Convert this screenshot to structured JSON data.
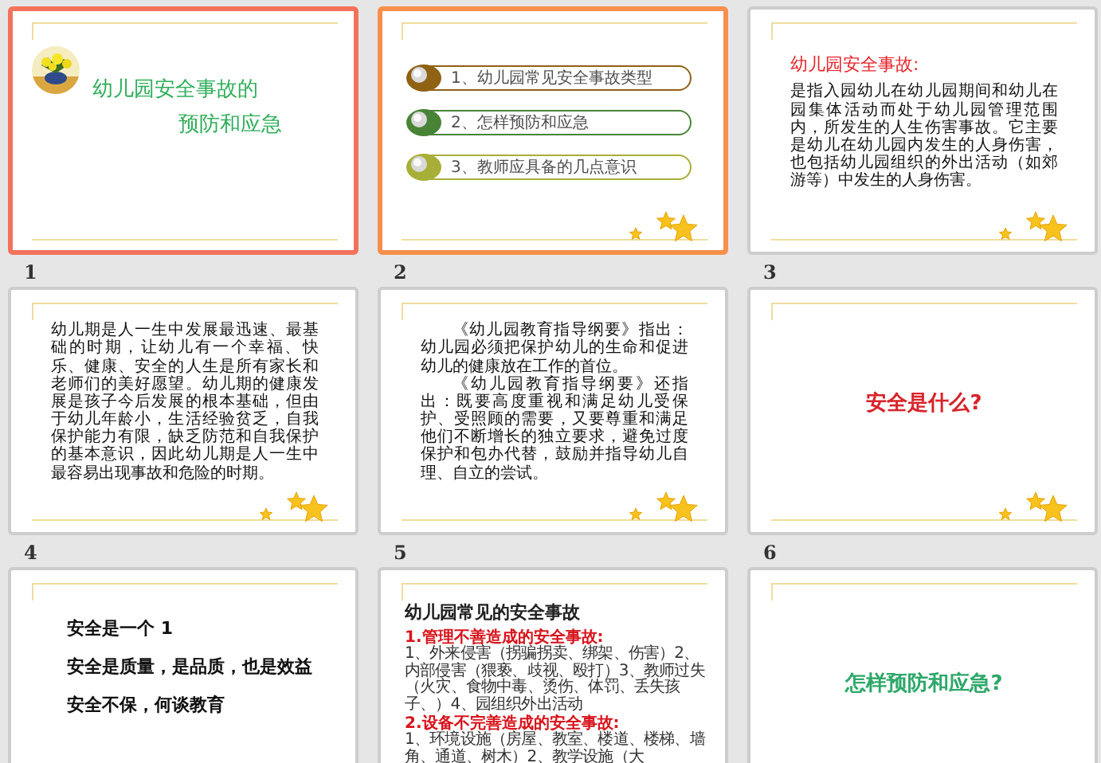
{
  "slides": [
    {
      "number": "1",
      "selected": true,
      "hovered": false,
      "kind": "title",
      "lines": [
        "幼儿园安全事故的",
        "预防和应急"
      ]
    },
    {
      "number": "2",
      "selected": false,
      "hovered": true,
      "kind": "menu",
      "items": [
        {
          "text": "1、幼儿园常见安全事故类型",
          "color": "#8a5a08"
        },
        {
          "text": "2、怎样预防和应急",
          "color": "#3f7d2c"
        },
        {
          "text": "3、教师应具备的几点意识",
          "color": "#a3ab2e"
        }
      ]
    },
    {
      "number": "3",
      "selected": false,
      "hovered": false,
      "kind": "heading_text",
      "heading": "幼儿园安全事故:",
      "paragraphs": [
        "是指入园幼儿在幼儿园期间和幼儿在园集体活动而处于幼儿园管理范围内，所发生的人生伤害事故。它主要是幼儿在幼儿园内发生的人身伤害，也包括幼儿园组织的外出活动（如郊游等）中发生的人身伤害。"
      ]
    },
    {
      "number": "4",
      "selected": false,
      "hovered": false,
      "kind": "text",
      "paragraphs": [
        "幼儿期是人一生中发展最迅速、最基础的时期，让幼儿有一个幸福、快乐、健康、安全的人生是所有家长和老师们的美好愿望。幼儿期的健康发展是孩子今后发展的根本基础，但由于幼儿年龄小，生活经验贫乏，自我保护能力有限，缺乏防范和自我保护的基本意识，因此幼儿期是人一生中最容易出现事故和危险的时期。"
      ]
    },
    {
      "number": "5",
      "selected": false,
      "hovered": false,
      "kind": "text",
      "paragraphs": [
        "《幼儿园教育指导纲要》指出：幼儿园必须把保护幼儿的生命和促进幼儿的健康放在工作的首位。",
        "《幼儿园教育指导纲要》还指出：既要高度重视和满足幼儿受保护、受照顾的需要，又要尊重和满足他们不断增长的独立要求，避免过度保护和包办代替，鼓励并指导幼儿自理、自立的尝试。"
      ]
    },
    {
      "number": "6",
      "selected": false,
      "hovered": false,
      "kind": "center",
      "text": "安全是什么?",
      "color": "#d8232a"
    },
    {
      "selected": false,
      "hovered": false,
      "kind": "list",
      "lines": [
        "安全是一个 1",
        "安全是质量，是品质，也是效益",
        "安全不保，何谈教育"
      ]
    },
    {
      "selected": false,
      "hovered": false,
      "kind": "sections",
      "title": "幼儿园常见的安全事故",
      "sections": [
        {
          "heading": "1.管理不善造成的安全事故:",
          "body": "1、外来侵害（拐骗拐卖、绑架、伤害）2、内部侵害（猥亵、歧视、殴打）3、教师过失（火灾、食物中毒、烫伤、体罚、丢失孩子、）4、园组织外出活动"
        },
        {
          "heading": "2.设备不完善造成的安全事故:",
          "body": "1、环境设施（房屋、教室、楼道、楼梯、墙角、通道、树木）2、教学设施（大"
        }
      ]
    },
    {
      "selected": false,
      "hovered": false,
      "kind": "center",
      "text": "怎样预防和应急?",
      "color": "#2ea86a"
    }
  ]
}
